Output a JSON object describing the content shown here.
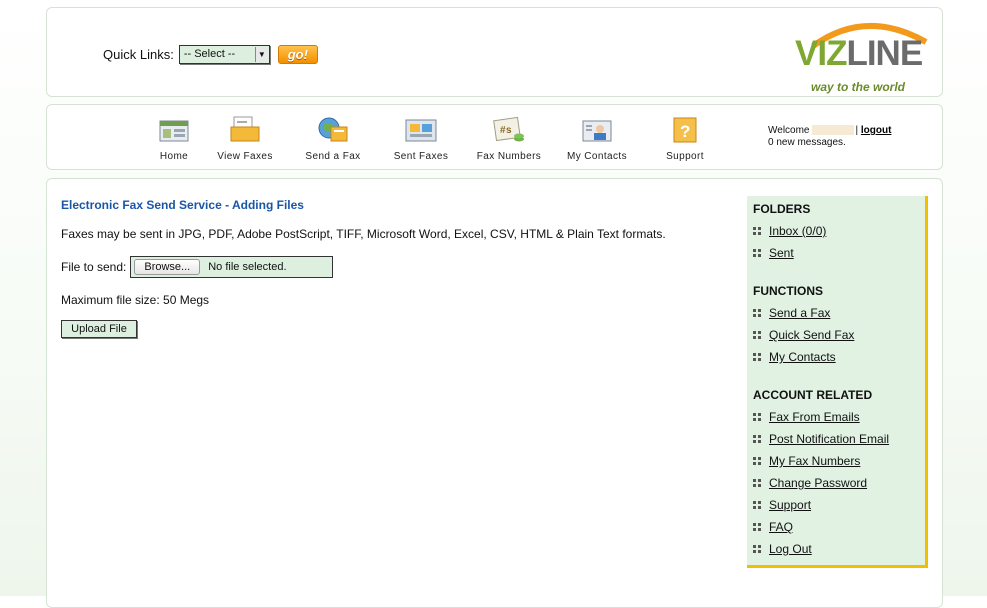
{
  "quicklinks": {
    "label": "Quick Links:",
    "selected": "-- Select --",
    "go": "go!"
  },
  "logo": {
    "viz": "VIZ",
    "line": "LINE",
    "tagline": "way to the world"
  },
  "nav": {
    "items": [
      {
        "label": "Home",
        "icon": "home-icon"
      },
      {
        "label": "View Faxes",
        "icon": "view-faxes-icon"
      },
      {
        "label": "Send a Fax",
        "icon": "send-fax-icon"
      },
      {
        "label": "Sent Faxes",
        "icon": "sent-faxes-icon"
      },
      {
        "label": "Fax Numbers",
        "icon": "fax-numbers-icon"
      },
      {
        "label": "My Contacts",
        "icon": "contacts-icon"
      },
      {
        "label": "Support",
        "icon": "support-icon"
      }
    ],
    "welcome": "Welcome",
    "separator": "|",
    "logout": "logout",
    "messages": "0 new messages."
  },
  "main": {
    "title": "Electronic Fax Send Service - Adding Files",
    "formats": "Faxes may be sent in JPG, PDF, Adobe PostScript, TIFF, Microsoft Word, Excel, CSV, HTML & Plain Text formats.",
    "file_label": "File to send:",
    "browse": "Browse...",
    "no_file": "No file selected.",
    "max_size": "Maximum file size: 50 Megs",
    "upload": "Upload File"
  },
  "sidebar": {
    "folders_heading": "FOLDERS",
    "folders": [
      "Inbox (0/0)",
      "Sent"
    ],
    "functions_heading": "FUNCTIONS",
    "functions": [
      "Send a Fax",
      "Quick Send Fax",
      "My Contacts"
    ],
    "account_heading": "ACCOUNT RELATED",
    "account": [
      "Fax From Emails",
      "Post Notification Email",
      "My Fax Numbers",
      "Change Password",
      "Support",
      "FAQ",
      "Log Out"
    ]
  },
  "colors": {
    "accent_blue": "#1a56a6",
    "sidebar_bg": "#e1f2e3",
    "sidebar_border": "#f0c000",
    "go_orange": "#f28f00",
    "logo_green": "#7fa832"
  }
}
